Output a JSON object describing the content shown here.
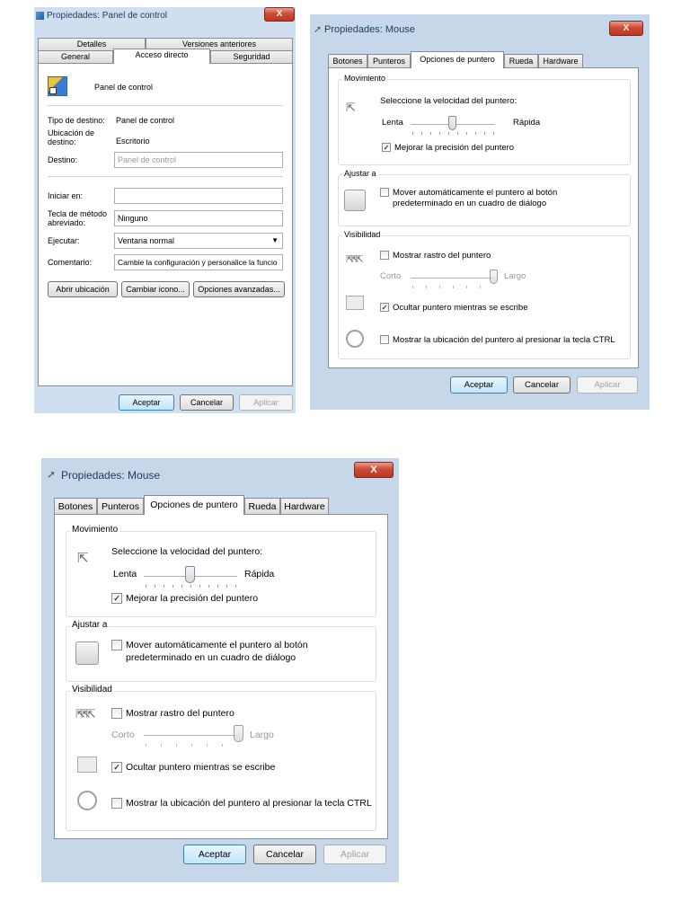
{
  "panel_window": {
    "title": "Propiedades: Panel de control",
    "close_label": "X",
    "tabs_row1": [
      "Detalles",
      "Versiones anteriores"
    ],
    "tabs_row2": [
      "General",
      "Acceso directo",
      "Seguridad"
    ],
    "shortcut_name": "Panel de control",
    "fields": {
      "target_type_label": "Tipo de destino:",
      "target_type_value": "Panel de control",
      "target_location_label": "Ubicación de destino:",
      "target_location_value": "Escritorio",
      "target_label": "Destino:",
      "target_value": "Panel de control",
      "start_in_label": "Iniciar en:",
      "start_in_value": "",
      "shortcut_key_label": "Tecla de método abreviado:",
      "shortcut_key_value": "Ninguno",
      "run_label": "Ejecutar:",
      "run_value": "Ventana normal",
      "comment_label": "Comentario:",
      "comment_value": "Cambie la configuración y personalice la funcio"
    },
    "buttons": {
      "open_location": "Abrir ubicación",
      "change_icon": "Cambiar icono...",
      "advanced": "Opciones avanzadas..."
    },
    "footer": {
      "ok": "Aceptar",
      "cancel": "Cancelar",
      "apply": "Aplicar"
    }
  },
  "mouse_window": {
    "title": "Propiedades: Mouse",
    "close_label": "X",
    "tabs": [
      "Botones",
      "Punteros",
      "Opciones de puntero",
      "Rueda",
      "Hardware"
    ],
    "active_tab": "Opciones de puntero",
    "motion": {
      "group_title": "Movimiento",
      "speed_label": "Seleccione la velocidad del puntero:",
      "slow": "Lenta",
      "fast": "Rápida",
      "speed_level": 0.5,
      "precision_label": "Mejorar la precisión del puntero",
      "precision_checked": true
    },
    "snap": {
      "group_title": "Ajustar a",
      "snap_label_line1": "Mover automáticamente el puntero al botón",
      "snap_label_line2": "predeterminado en un cuadro de diálogo",
      "snap_checked": false
    },
    "visibility": {
      "group_title": "Visibilidad",
      "trails_label": "Mostrar rastro del puntero",
      "trails_checked": false,
      "short": "Corto",
      "long": "Largo",
      "trail_level": 1.0,
      "hide_label": "Ocultar puntero mientras se escribe",
      "hide_checked": true,
      "ctrl_label": "Mostrar la ubicación del puntero al presionar la tecla CTRL",
      "ctrl_checked": false
    },
    "footer": {
      "ok": "Aceptar",
      "cancel": "Cancelar",
      "apply": "Aplicar"
    }
  }
}
